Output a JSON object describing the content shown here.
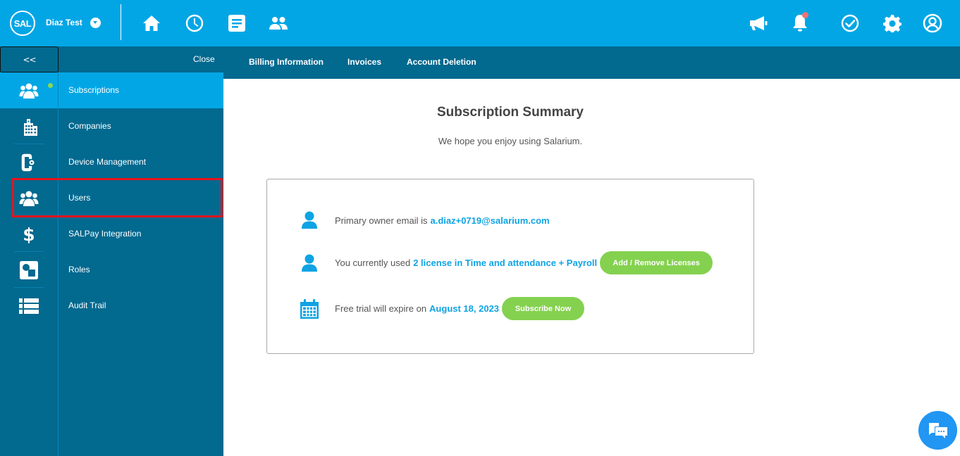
{
  "topbar": {
    "logo_text": "SAL",
    "company_name": "Diaz Test",
    "nav_icons": [
      "home-icon",
      "clock-icon",
      "document-icon",
      "people-icon"
    ],
    "right_icons": [
      "megaphone-icon",
      "bell-icon",
      "check-circle-icon",
      "gear-icon",
      "user-profile-icon"
    ],
    "notification_dot_color": "#ef7373",
    "background_color": "#03a6e5"
  },
  "subbar": {
    "collapse_label": "<<",
    "close_label": "Close",
    "tabs": [
      {
        "label": "Billing Information"
      },
      {
        "label": "Invoices"
      },
      {
        "label": "Account Deletion"
      }
    ]
  },
  "sidebar": {
    "items": [
      {
        "label": "Subscriptions",
        "icon": "users-group-icon",
        "active": true
      },
      {
        "label": "Companies",
        "icon": "building-icon"
      },
      {
        "label": "Device Management",
        "icon": "device-settings-icon"
      },
      {
        "label": "Users",
        "icon": "users-group-icon",
        "highlighted": true
      },
      {
        "label": "SALPay Integration",
        "icon": "dollar-icon"
      },
      {
        "label": "Roles",
        "icon": "roles-shapes-icon"
      },
      {
        "label": "Audit Trail",
        "icon": "list-table-icon"
      }
    ]
  },
  "main": {
    "title": "Subscription Summary",
    "subtitle": "We hope you enjoy using Salarium.",
    "rows": [
      {
        "prefix": "Primary owner email is",
        "value": "a.diaz+0719@salarium.com",
        "icon": "user-icon"
      },
      {
        "prefix": "You currently used",
        "value": "2 license in Time and attendance + Payroll",
        "icon": "user-icon",
        "button": "Add / Remove Licenses"
      },
      {
        "prefix": "Free trial will expire on",
        "value": "August 18, 2023",
        "icon": "calendar-icon",
        "button": "Subscribe Now"
      }
    ]
  },
  "colors": {
    "accent": "#0fa3e4",
    "button_green": "#84d14f",
    "sidebar_bg": "#02698f",
    "highlight_border": "#e8141c"
  }
}
